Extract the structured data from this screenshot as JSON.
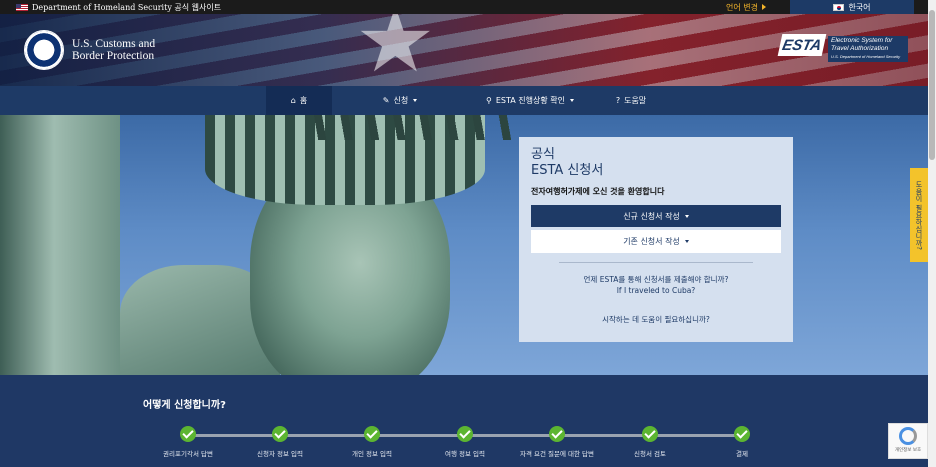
{
  "topbar": {
    "gov_label": "Department of Homeland Security 공식 웹사이트",
    "lang_change": "언어 변경",
    "current_language": "한국어"
  },
  "header": {
    "agency_line1": "U.S. Customs and",
    "agency_line2": "Border Protection",
    "esta_badge": "ESTA",
    "esta_sub_line1": "Electronic System for",
    "esta_sub_line2": "Travel Authorization",
    "esta_sub_line3": "U.S. Department of Homeland Security"
  },
  "nav": {
    "items": [
      {
        "icon": "home-icon",
        "label": "홈"
      },
      {
        "icon": "pencil-icon",
        "label": "신청"
      },
      {
        "icon": "search-icon",
        "label": "ESTA 진행상황 확인"
      },
      {
        "icon": "help-icon",
        "label": "도움말"
      }
    ]
  },
  "panel": {
    "official_line1": "공식",
    "official_line2": "ESTA 신청서",
    "welcome": "전자여행허가제에 오신 것을 환영합니다",
    "new_app_button": "신규 신청서 작성",
    "existing_app_button": "기존 신청서 작성",
    "link_when": "언제 ESTA를 통해 신청서를 제출해야 합니까?",
    "link_cuba": "If I traveled to Cuba?",
    "link_help": "시작하는 데 도움이 필요하십니까?"
  },
  "side_tab": "도움이 필요하십니까?",
  "steps": {
    "heading": "어떻게 신청합니까?",
    "items": [
      {
        "label": "권리포기각서 답변"
      },
      {
        "label": "신청자 정보 입력"
      },
      {
        "label": "개인 정보 입력"
      },
      {
        "label": "여행 정보 입력"
      },
      {
        "label": "자격 요건 질문에 대한 답변"
      },
      {
        "label": "신청서 검토"
      },
      {
        "label": "결제"
      }
    ]
  },
  "recaptcha": "개인정보 보호"
}
